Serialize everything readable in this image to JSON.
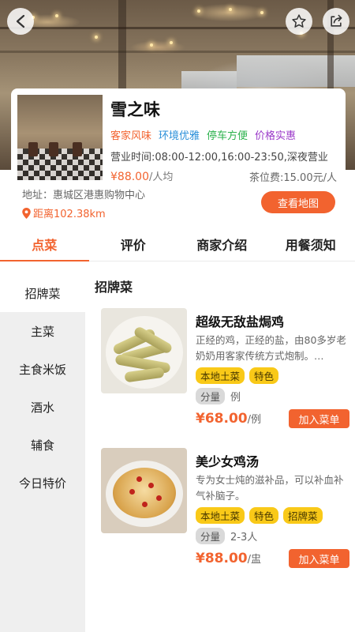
{
  "header": {
    "back_icon": "chevron-left-icon",
    "favorite_icon": "star-icon",
    "share_icon": "share-icon"
  },
  "restaurant": {
    "name": "雪之味",
    "features": [
      "客家风味",
      "环境优雅",
      "停车方便",
      "价格实惠"
    ],
    "feature_colors": [
      "#f2632f",
      "#2a8fd9",
      "#2bb24c",
      "#9b3ac9"
    ],
    "hours": "营业时间:08:00-12:00,16:00-23:50,深夜营业",
    "price": "¥88.00",
    "price_unit": "/人均",
    "tea_fee": "茶位费:15.00元/人",
    "address": "地址：惠城区港惠购物中心",
    "distance": "距离102.38km",
    "map_button": "查看地图"
  },
  "tabs": [
    {
      "label": "点菜",
      "active": true
    },
    {
      "label": "评价",
      "active": false
    },
    {
      "label": "商家介绍",
      "active": false
    },
    {
      "label": "用餐须知",
      "active": false
    }
  ],
  "sidebar": {
    "items": [
      "招牌菜",
      "主菜",
      "主食米饭",
      "酒水",
      "辅食",
      "今日特价"
    ],
    "active_index": 0
  },
  "section_title": "招牌菜",
  "dishes": [
    {
      "name": "超级无敌盐焗鸡",
      "description": "正经的鸡，正经的盐，由80多岁老奶奶用客家传统方式炮制。…",
      "tags": [
        "本地土菜",
        "特色"
      ],
      "portion_label": "分量",
      "portion_value": "例",
      "price": "¥68.00",
      "price_unit": "/例",
      "add_button": "加入菜单"
    },
    {
      "name": "美少女鸡汤",
      "description": "专为女士炖的滋补品，可以补血补气补脑子。",
      "tags": [
        "本地土菜",
        "特色",
        "招牌菜"
      ],
      "portion_label": "分量",
      "portion_value": "2-3人",
      "price": "¥88.00",
      "price_unit": "/盅",
      "add_button": "加入菜单"
    }
  ],
  "colors": {
    "accent": "#f2632f",
    "tag_yellow": "#f9c918",
    "sidebar_bg": "#efefef"
  }
}
